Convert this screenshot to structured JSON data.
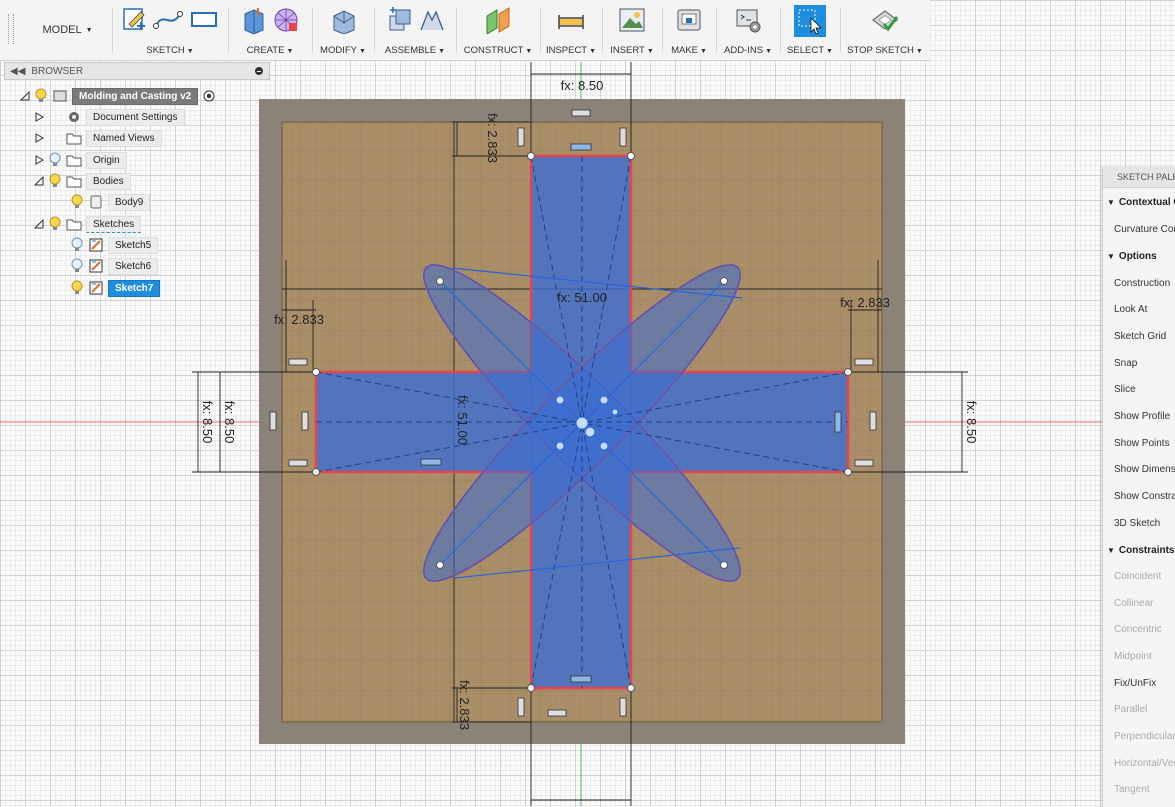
{
  "toolbar": {
    "mode": "MODEL",
    "groups": [
      {
        "key": "sketch",
        "label": "SKETCH"
      },
      {
        "key": "create",
        "label": "CREATE"
      },
      {
        "key": "modify",
        "label": "MODIFY"
      },
      {
        "key": "assemble",
        "label": "ASSEMBLE"
      },
      {
        "key": "construct",
        "label": "CONSTRUCT"
      },
      {
        "key": "inspect",
        "label": "INSPECT"
      },
      {
        "key": "insert",
        "label": "INSERT"
      },
      {
        "key": "make",
        "label": "MAKE"
      },
      {
        "key": "addins",
        "label": "ADD-INS"
      },
      {
        "key": "select",
        "label": "SELECT"
      },
      {
        "key": "stop",
        "label": "STOP SKETCH"
      }
    ]
  },
  "browser": {
    "title": "BROWSER",
    "root": "Molding and Casting v2",
    "items": {
      "document_settings": "Document Settings",
      "named_views": "Named Views",
      "origin": "Origin",
      "bodies": "Bodies",
      "body9": "Body9",
      "sketches": "Sketches",
      "sketch5": "Sketch5",
      "sketch6": "Sketch6",
      "sketch7": "Sketch7"
    }
  },
  "sketch_palette": {
    "title": "SKETCH PALETTE",
    "sections": {
      "contextual": "Contextual Commands",
      "options": "Options",
      "constraints": "Constraints"
    },
    "contextual_items": [
      "Curvature Comb Display"
    ],
    "options_items": [
      "Construction",
      "Look At",
      "Sketch Grid",
      "Snap",
      "Slice",
      "Show Profile",
      "Show Points",
      "Show Dimensions",
      "Show Constraints",
      "3D Sketch"
    ],
    "constraint_items": [
      "Coincident",
      "Collinear",
      "Concentric",
      "Midpoint",
      "Fix/UnFix",
      "Parallel",
      "Perpendicular",
      "Horizontal/Vertical",
      "Tangent"
    ]
  },
  "dimensions": {
    "width_top": "fx: 8.50",
    "top_offset": "fx: 2.833",
    "left_offset": "fx: 2.833",
    "right_offset": "fx: 2.833",
    "total_h": "fx: 51.00",
    "total_v": "fx: 51.00",
    "left_height_outer": "fx: 8.50",
    "left_height_inner": "fx: 8.50",
    "right_height": "fx: 8.50",
    "bottom_offset": "fx: 2.833"
  },
  "colors": {
    "accent": "#1e8ede",
    "mold_outer": "#8c8378",
    "mold_inner": "#a88c66",
    "profile_fill": "#4a78c4",
    "profile_edge": "#e8434f",
    "sketch_line": "#2266dd"
  }
}
